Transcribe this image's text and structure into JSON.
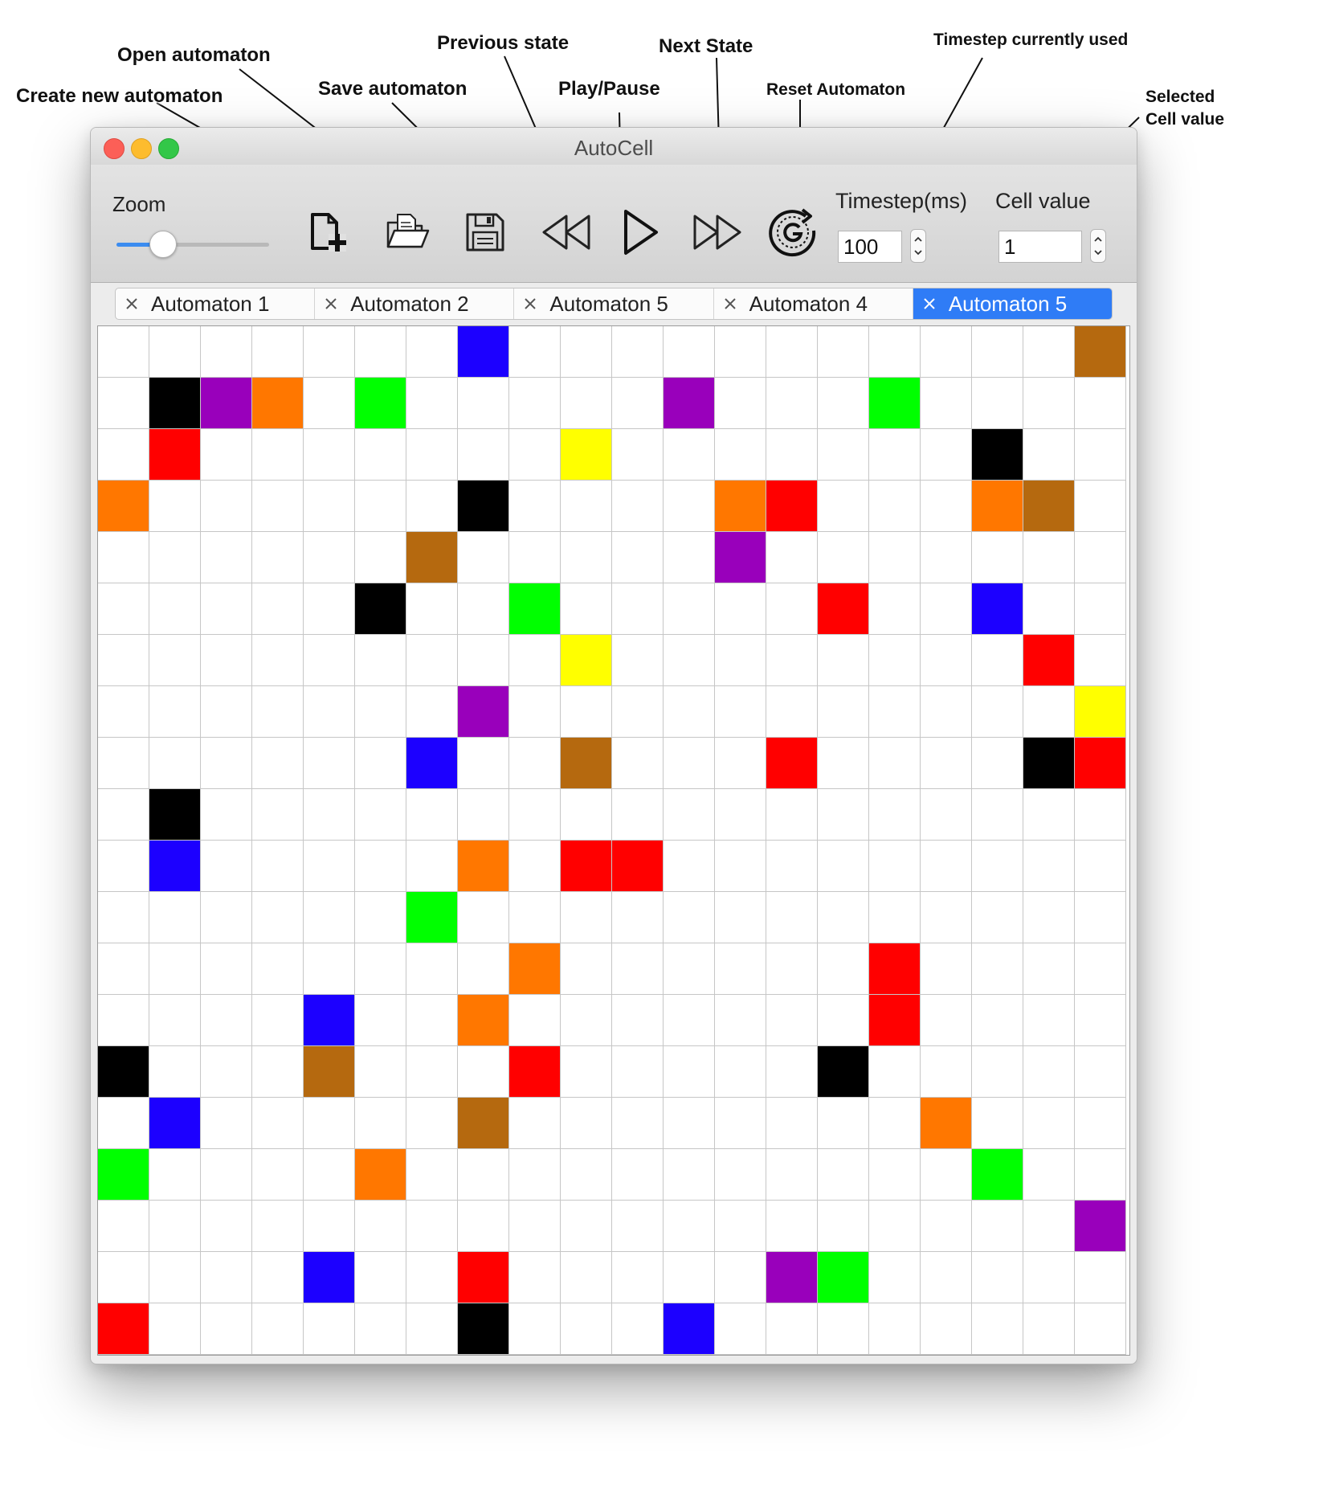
{
  "annotations": {
    "create_new": "Create new automaton",
    "open": "Open automaton",
    "save": "Save automaton",
    "previous": "Previous state",
    "play_pause": "Play/Pause",
    "next": "Next State",
    "reset": "Reset Automaton",
    "timestep_used": "Timestep currently used",
    "selected_cell_line1": "Selected",
    "selected_cell_line2": "Cell value"
  },
  "window": {
    "title": "AutoCell"
  },
  "toolbar": {
    "zoom_label": "Zoom",
    "zoom_level": 0.3,
    "timestep_label": "Timestep(ms)",
    "timestep_value": "100",
    "cell_value_label": "Cell value",
    "cell_value": "1",
    "icons": [
      "new-automaton-icon",
      "open-folder-icon",
      "save-floppy-icon",
      "rewind-icon",
      "play-icon",
      "fast-forward-icon",
      "reset-icon"
    ]
  },
  "tabs": [
    {
      "label": "Automaton 1",
      "active": false
    },
    {
      "label": "Automaton 2",
      "active": false
    },
    {
      "label": "Automaton 5",
      "active": false
    },
    {
      "label": "Automaton 4",
      "active": false
    },
    {
      "label": "Automaton 5",
      "active": true
    }
  ],
  "grid": {
    "columns": 20,
    "rows": 20,
    "palette": {
      "K": "#000000",
      "P": "#9900bb",
      "O": "#ff7700",
      "G": "#00ff00",
      "R": "#ff0000",
      "Y": "#ffff00",
      "B": "#1c00ff",
      "N": "#b5690f"
    },
    "cells": [
      ".......B...........N",
      ".KPO.G.....P...G....",
      ".R.......Y.......K..",
      "O......K....OR...ON.",
      "......N.....P.......",
      ".....K..G.....R..B..",
      ".........Y........R.",
      ".......P...........Y",
      "......B..N...R....KR",
      ".K..................",
      ".B.....O.RR.........",
      "......G.............",
      "........O......R....",
      "....B..O.......R....",
      "K...N...R.....K.....",
      ".B.....N........O...",
      "G....O...........G..",
      "...................P",
      "....B..R.....PG.....",
      "R......K...B........"
    ]
  }
}
